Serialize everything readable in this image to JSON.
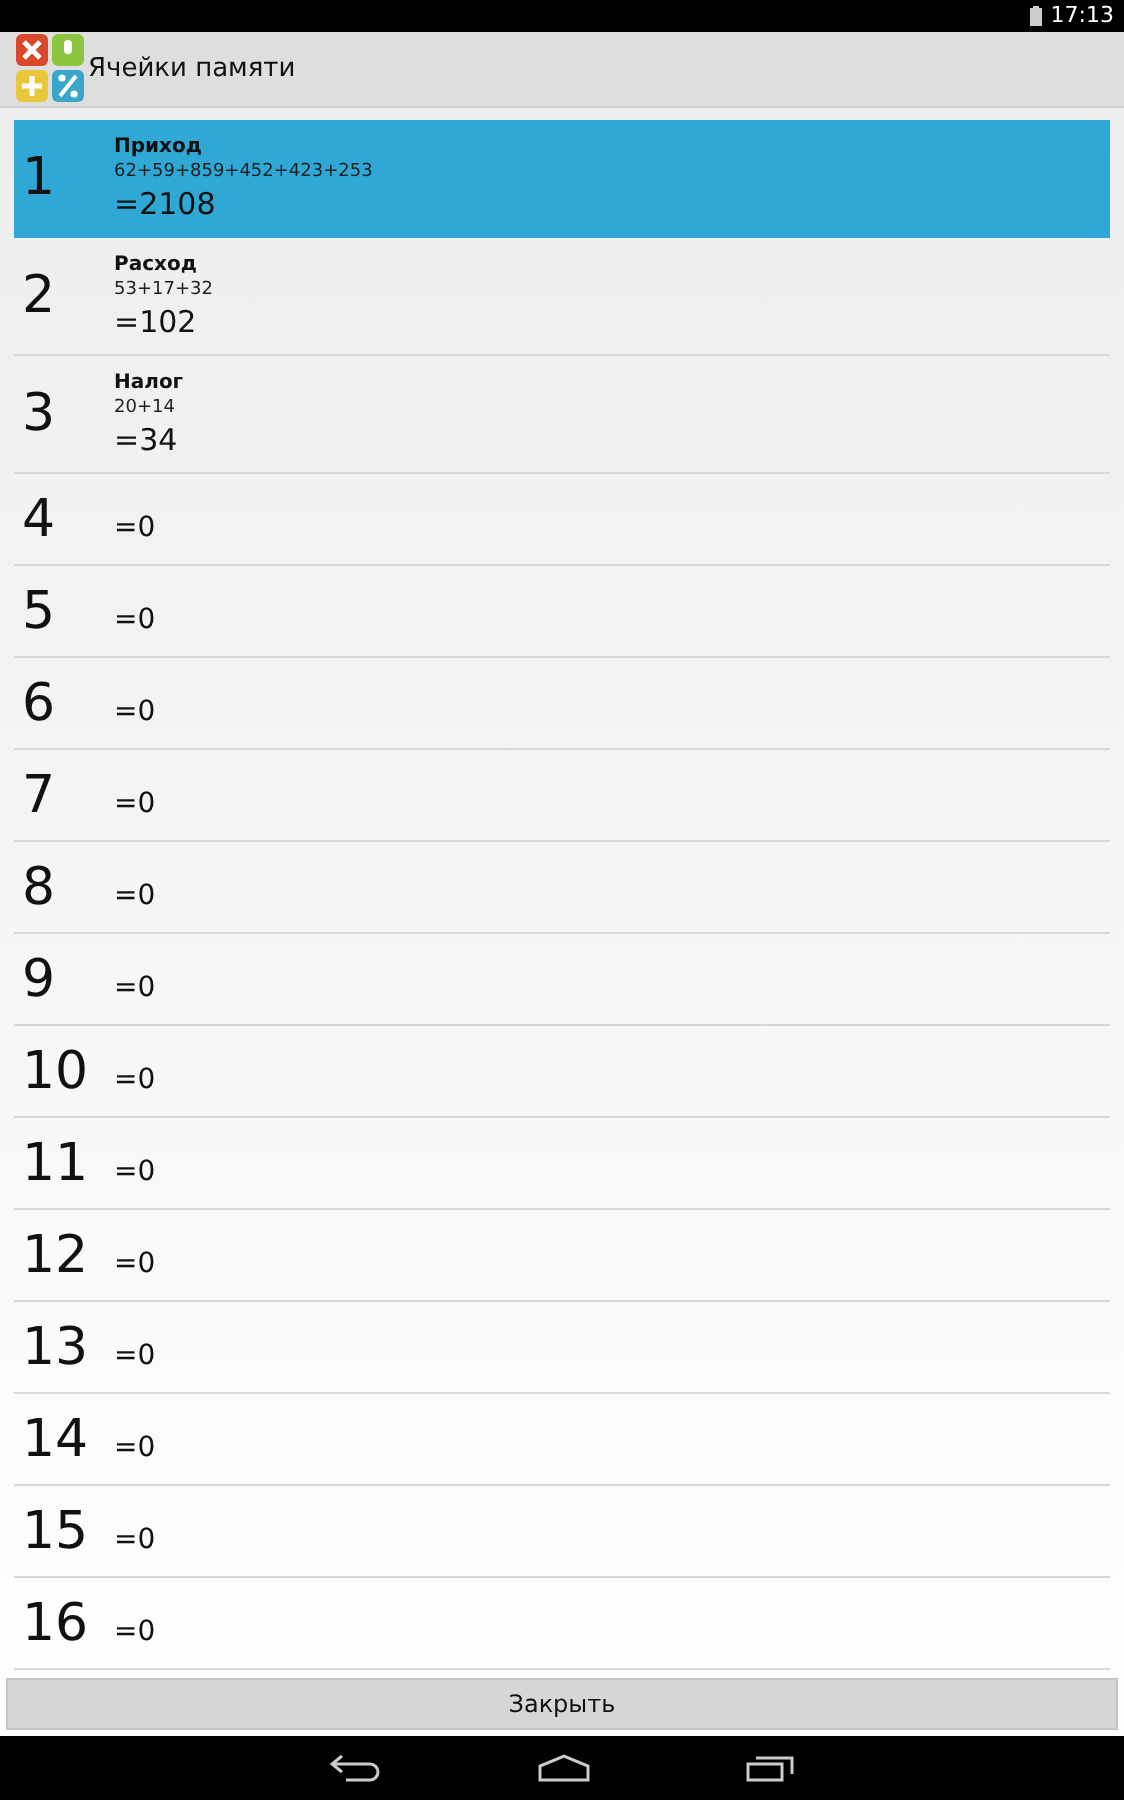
{
  "status_bar": {
    "time": "17:13"
  },
  "title_bar": {
    "title": "Ячейки памяти"
  },
  "cells": [
    {
      "number": "1",
      "name": "Приход",
      "expression": "62+59+859+452+423+253",
      "result": "=2108",
      "selected": true
    },
    {
      "number": "2",
      "name": "Расход",
      "expression": "53+17+32",
      "result": "=102",
      "selected": false
    },
    {
      "number": "3",
      "name": "Налог",
      "expression": "20+14",
      "result": "=34",
      "selected": false
    },
    {
      "number": "4",
      "result": "=0",
      "selected": false
    },
    {
      "number": "5",
      "result": "=0",
      "selected": false
    },
    {
      "number": "6",
      "result": "=0",
      "selected": false
    },
    {
      "number": "7",
      "result": "=0",
      "selected": false
    },
    {
      "number": "8",
      "result": "=0",
      "selected": false
    },
    {
      "number": "9",
      "result": "=0",
      "selected": false
    },
    {
      "number": "10",
      "result": "=0",
      "selected": false
    },
    {
      "number": "11",
      "result": "=0",
      "selected": false
    },
    {
      "number": "12",
      "result": "=0",
      "selected": false
    },
    {
      "number": "13",
      "result": "=0",
      "selected": false
    },
    {
      "number": "14",
      "result": "=0",
      "selected": false
    },
    {
      "number": "15",
      "result": "=0",
      "selected": false
    },
    {
      "number": "16",
      "result": "=0",
      "selected": false
    }
  ],
  "close_button": "Закрыть"
}
